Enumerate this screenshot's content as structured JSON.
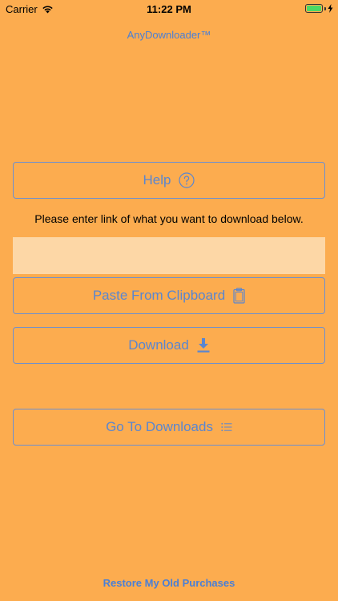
{
  "status_bar": {
    "carrier": "Carrier",
    "time": "11:22 PM"
  },
  "app": {
    "title": "AnyDownloader™"
  },
  "buttons": {
    "help": "Help",
    "paste": "Paste From Clipboard",
    "download": "Download",
    "go_to_downloads": "Go To Downloads"
  },
  "prompt": "Please enter link of what you want to download below.",
  "link_input": {
    "value": "",
    "placeholder": ""
  },
  "footer": {
    "restore": "Restore My Old Purchases"
  },
  "colors": {
    "background": "#FCAC4F",
    "accent": "#5A86D0",
    "input_bg": "#FDD7A6",
    "battery": "#4CD964"
  },
  "icons": {
    "help": "question-circle-icon",
    "paste": "clipboard-icon",
    "download": "download-arrow-icon",
    "downloads_list": "list-icon",
    "wifi": "wifi-icon",
    "battery": "battery-icon"
  }
}
